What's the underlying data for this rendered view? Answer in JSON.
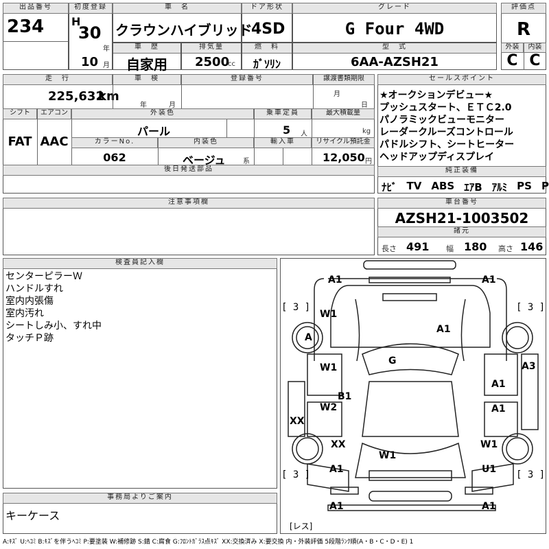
{
  "header": {
    "lot_no_label": "出品番号",
    "lot_no": "234",
    "first_reg_label": "初度登録",
    "era": "H",
    "year": "30",
    "year_unit": "年",
    "month": "10",
    "month_unit": "月",
    "name_label": "車　名",
    "name": "クラウンハイブリッド",
    "door_label": "ドア形状",
    "door": "4SD",
    "grade_label": "グレード",
    "grade": "G Four 4WD",
    "score_label": "評価点",
    "score": "R",
    "history_label": "車　歴",
    "history": "自家用",
    "disp_label": "排気量",
    "disp": "2500",
    "disp_unit": "cc",
    "fuel_label": "燃　料",
    "fuel": "ｶﾞｿﾘﾝ",
    "model_label": "型　式",
    "model": "6AA-AZSH21",
    "ext_label": "外装",
    "ext": "C",
    "int_label": "内装",
    "int": "C"
  },
  "row2": {
    "mileage_label": "走　行",
    "mileage": "225,632",
    "mileage_unit": "km",
    "inspection_label": "車　検",
    "insp_year_unit": "年",
    "insp_month_unit": "月",
    "reg_label": "登録番号",
    "transfer_label": "譲渡書類期限",
    "transfer_month": "月",
    "transfer_day": "日",
    "shift_label": "シフト",
    "shift": "FAT",
    "ac_label": "エアコン",
    "ac": "AAC",
    "color_label": "外装色",
    "color": "パール",
    "cap_label": "乗車定員",
    "cap": "5",
    "cap_unit": "人",
    "load_label": "最大積載量",
    "load_unit": "kg",
    "color_no_label": "カラーNo.",
    "color_no": "062",
    "int_color_label": "内装色",
    "int_color": "ベージュ",
    "int_color_unit": "系",
    "import_label": "輸入車",
    "recycle_label": "リサイクル預託金",
    "recycle": "12,050",
    "recycle_unit": "円",
    "later_label": "後日発送部品"
  },
  "sales": {
    "label": "セールスポイント",
    "items": [
      "★オークションデビュー★",
      "プッシュスタート、ＥＴＣ2.0",
      "パノラミックビューモニター",
      "レーダークルーズコントロール",
      "パドルシフト、シートヒーター",
      "ヘッドアップディスプレイ"
    ]
  },
  "equipment": {
    "label": "純正装備",
    "items": [
      "ﾅﾋﾞ",
      "TV",
      "ABS",
      "ｴｱB",
      "ｱﾙﾐ",
      "PS",
      "PW"
    ]
  },
  "notes": {
    "label": "注意事項欄"
  },
  "chassis": {
    "label": "車台番号",
    "number": "AZSH21-1003502",
    "dims_label": "諸元",
    "length_label": "長さ",
    "length": "491",
    "width_label": "幅",
    "width": "180",
    "height_label": "高さ",
    "height": "146"
  },
  "inspector": {
    "label": "検査員記入欄",
    "items": [
      "センターピラーＷ",
      "ハンドルすれ",
      "室内内張傷",
      "室内汚れ",
      "シートしみ小、すれ中",
      "タッチＰ跡"
    ]
  },
  "office": {
    "label": "事務局よりご案内",
    "items": [
      "キーケース"
    ]
  },
  "diagram": {
    "marks": [
      "A1",
      "A1",
      "W1",
      "A1",
      "A",
      "G",
      "A3",
      "W1",
      "A1",
      "B1",
      "W2",
      "A1",
      "XX",
      "XX",
      "W1",
      "W1",
      "A1",
      "U1",
      "A1",
      "A1"
    ],
    "brackets": [
      "[ 3 ]",
      "[ 3 ]",
      "[ 3 ]",
      "[ 3 ]"
    ],
    "res_label": "[レス]"
  },
  "legend": "A:ｷｽﾞ U:ﾍｺﾐ B:ｷｽﾞを伴うﾍｺﾐ P:要塗装 W:補修跡 S:錆 C:腐食 G:ﾌﾛﾝﾄｶﾞﾗｽ点ｷｽﾞ XX:交換済み X:要交換 内・外装評価 5段階ﾗﾝｸ順(A・B・C・D・E) 1"
}
